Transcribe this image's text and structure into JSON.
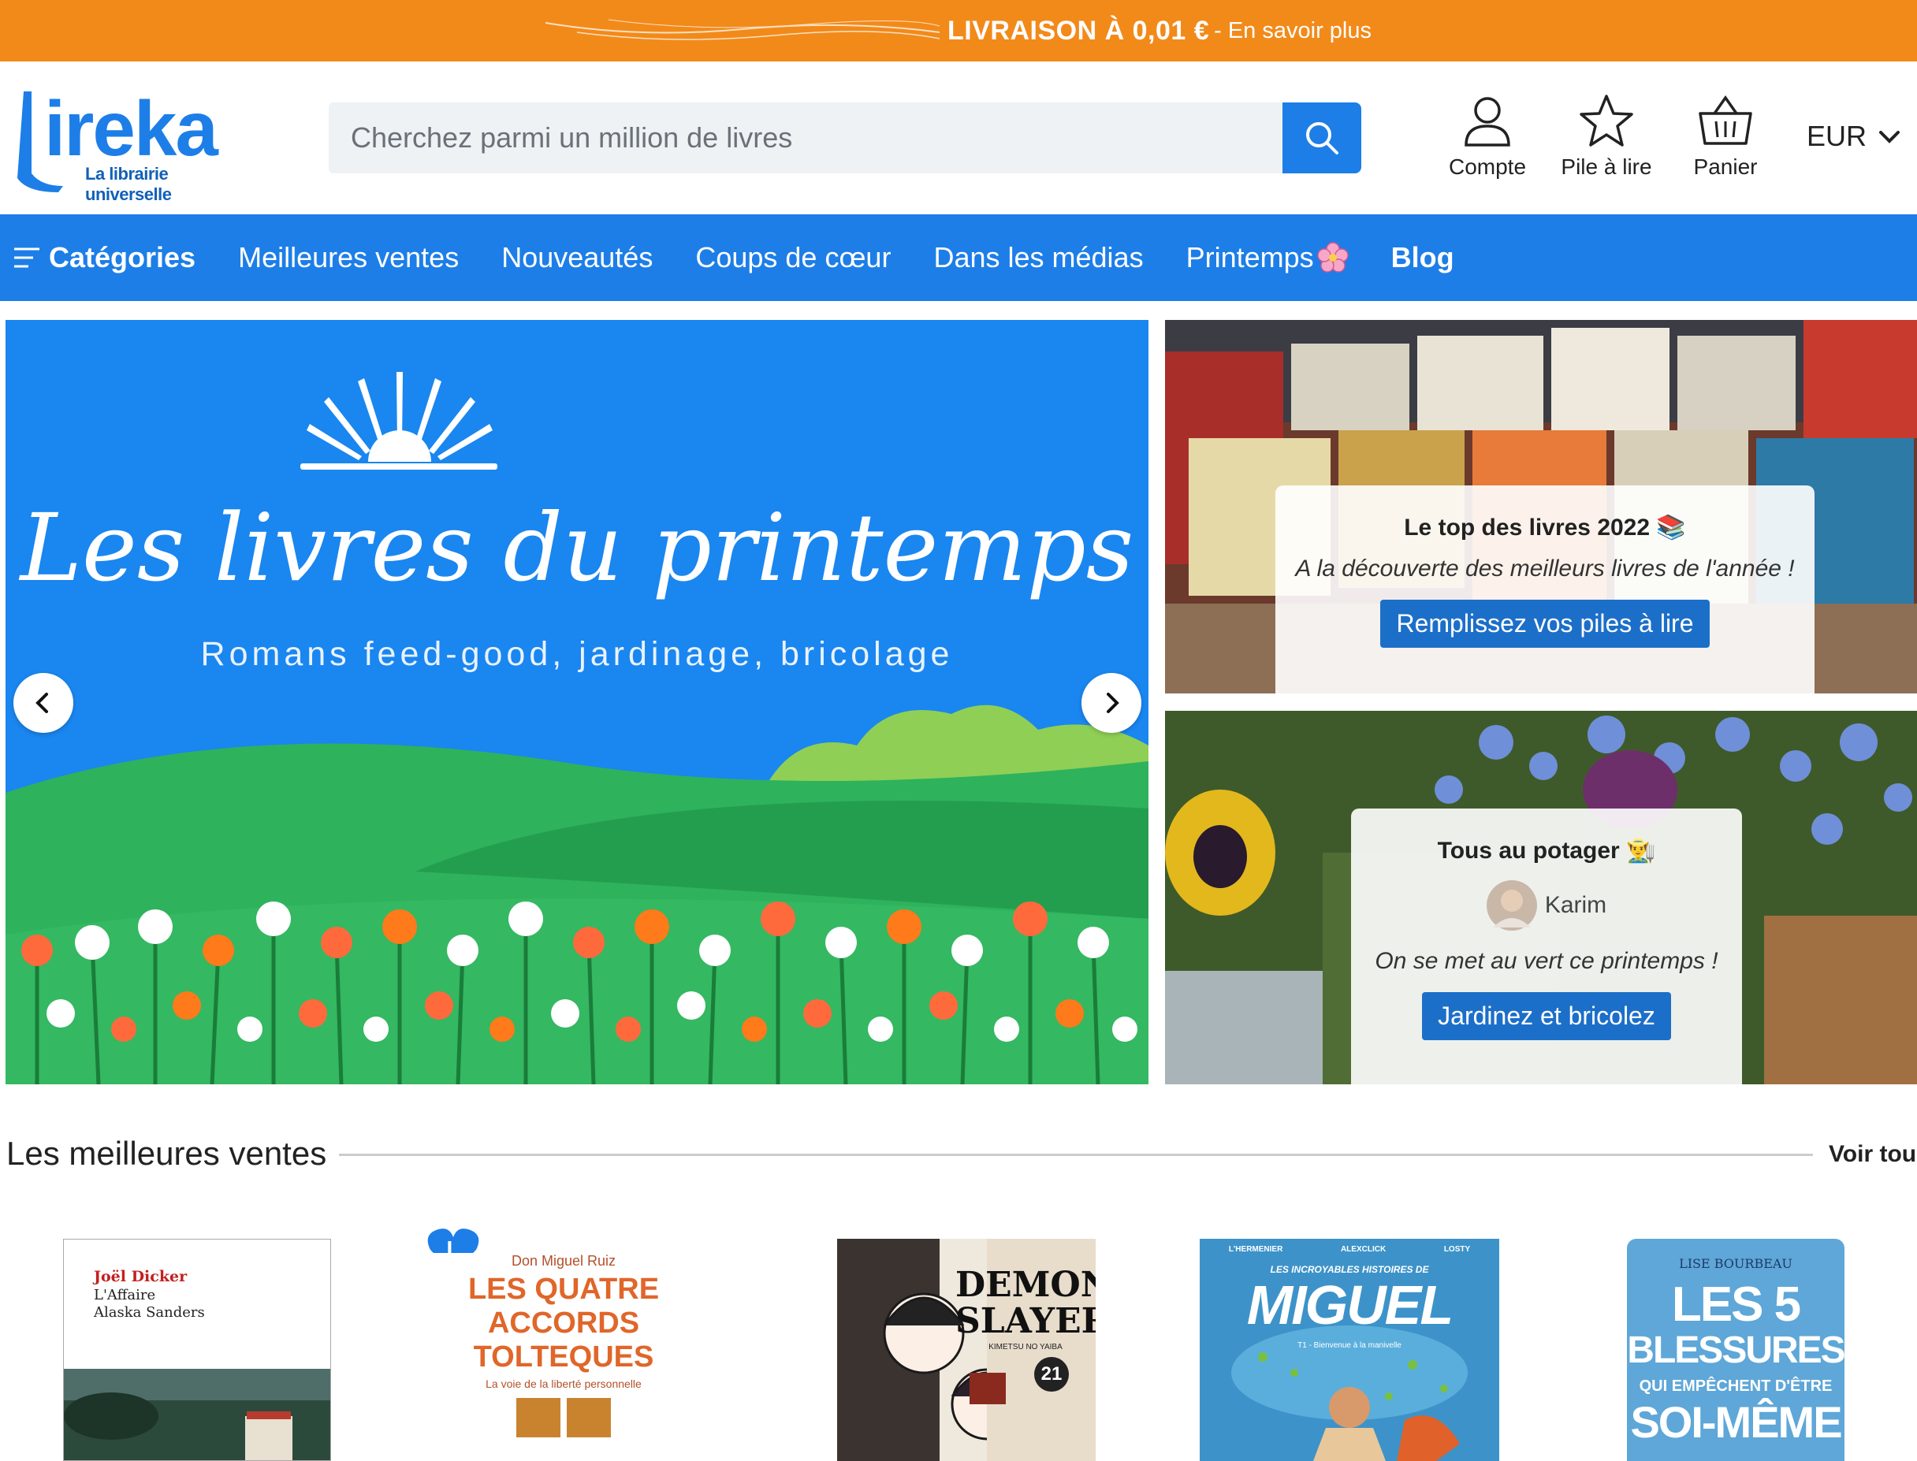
{
  "promo": {
    "strong": "LIVRAISON À 0,01 €",
    "light": "- En savoir plus"
  },
  "header": {
    "logo_word": "ireka",
    "logo_tagline": "La librairie universelle",
    "search_placeholder": "Cherchez parmi un million de livres",
    "account_label": "Compte",
    "wishlist_label": "Pile à lire",
    "cart_label": "Panier",
    "currency": "EUR"
  },
  "nav": {
    "categories": "Catégories",
    "items": [
      "Meilleures ventes",
      "Nouveautés",
      "Coups de cœur",
      "Dans les médias",
      "Printemps"
    ],
    "blog": "Blog"
  },
  "hero": {
    "title": "Les livres du printemps",
    "subtitle": "Romans feed-good, jardinage, bricolage"
  },
  "card_top": {
    "title": "Le top des livres 2022 📚",
    "text": "A la découverte des meilleurs livres de l'année !",
    "button": "Remplissez vos piles à lire"
  },
  "card_bottom": {
    "title": "Tous au potager 👨‍🌾",
    "author": "Karim",
    "text": "On se met au vert ce printemps !",
    "button": "Jardinez et bricolez"
  },
  "bestsellers": {
    "title": "Les meilleures ventes",
    "link": "Voir tou",
    "books": [
      {
        "author": "Joël Dicker",
        "title_line1": "L'Affaire",
        "title_line2": "Alaska Sanders"
      },
      {
        "author": "Don Miguel Ruiz",
        "title_line1": "LES QUATRE",
        "title_line2": "ACCORDS",
        "title_line3": "TOLTEQUES",
        "tagline": "La voie de la liberté personnelle"
      },
      {
        "title_line1": "DEMON",
        "title_line2": "SLAYER",
        "subtitle": "KIMETSU NO YAIBA",
        "volume": "21"
      },
      {
        "credits": [
          "L'HERMENIER",
          "ALEXCLICK",
          "LOSTY"
        ],
        "title_small": "LES INCROYABLES HISTOIRES DE",
        "title_big": "MIGUEL",
        "tome": "T1 - Bienvenue à la manivelle"
      },
      {
        "author": "LISE BOURBEAU",
        "title_line1": "LES 5",
        "title_line2": "BLESSURES",
        "title_line3": "QUI EMPÊCHENT D'ÊTRE",
        "title_line4": "SOI-MÊME"
      }
    ]
  },
  "colors": {
    "brand_blue": "#1d7ee8",
    "promo_orange": "#f28a1a",
    "button_blue": "#1c6fc9"
  }
}
